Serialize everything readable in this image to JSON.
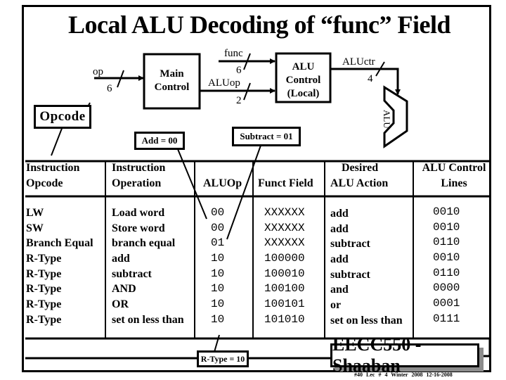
{
  "slide": {
    "title": "Local ALU Decoding of “func” Field"
  },
  "diagram": {
    "op_label": "op",
    "op_width": "6",
    "main_control": [
      "Main",
      "Control"
    ],
    "func_label": "func",
    "func_width": "6",
    "aluop_label": "ALUop",
    "aluop_width": "2",
    "alu_control": [
      "ALU",
      "Control",
      "(Local)"
    ],
    "aluctr_label": "ALUctr",
    "aluctr_width": "4",
    "alu_label": "ALU",
    "callouts": {
      "opcode": "Opcode",
      "add": "Add = 00",
      "subtract": "Subtract = 01",
      "rtype": "R-Type = 10"
    }
  },
  "table": {
    "headers": {
      "opcode": [
        "Instruction",
        "Opcode"
      ],
      "operation": [
        "Instruction",
        "Operation"
      ],
      "aluop": "ALUOp",
      "funct": "Funct Field",
      "action": [
        "Desired",
        "ALU Action"
      ],
      "control": [
        "ALU Control",
        "Lines"
      ]
    },
    "rows": [
      {
        "opcode": "LW",
        "operation": "Load word",
        "aluop": "00",
        "funct": "XXXXXX",
        "action": "add",
        "control": "0010"
      },
      {
        "opcode": "SW",
        "operation": "Store word",
        "aluop": "00",
        "funct": "XXXXXX",
        "action": "add",
        "control": "0010"
      },
      {
        "opcode": "Branch Equal",
        "operation": "branch equal",
        "aluop": "01",
        "funct": "XXXXXX",
        "action": "subtract",
        "control": "0110"
      },
      {
        "opcode": "R-Type",
        "operation": "add",
        "aluop": "10",
        "funct": "100000",
        "action": "add",
        "control": "0010"
      },
      {
        "opcode": "R-Type",
        "operation": "subtract",
        "aluop": "10",
        "funct": "100010",
        "action": "subtract",
        "control": "0110"
      },
      {
        "opcode": "R-Type",
        "operation": "AND",
        "aluop": "10",
        "funct": "100100",
        "action": "and",
        "control": "0000"
      },
      {
        "opcode": "R-Type",
        "operation": "OR",
        "aluop": "10",
        "funct": "100101",
        "action": "or",
        "control": "0001"
      },
      {
        "opcode": "R-Type",
        "operation": "set on less than",
        "aluop": "10",
        "funct": "101010",
        "action": "set on less than",
        "control": "0111"
      }
    ]
  },
  "footer": {
    "course": "EECC550 - Shaaban",
    "meta": "#40  Lec # 4  Winter 2008  12-16-2008"
  }
}
